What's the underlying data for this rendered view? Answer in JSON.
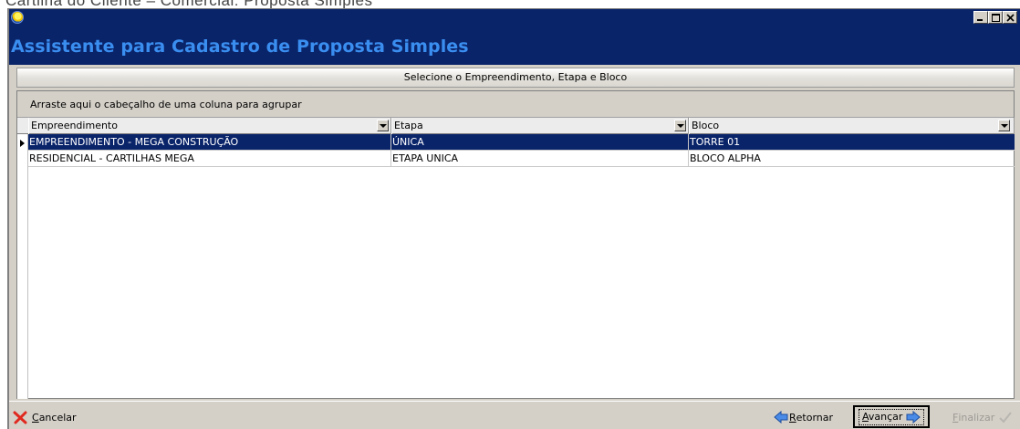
{
  "document_caption": "Cartilha do Cliente – Comercial: Proposta Simples",
  "window": {
    "title_icon": "app-globe-icon",
    "controls": [
      "minimize-icon",
      "maximize-icon",
      "close-icon"
    ]
  },
  "wizard": {
    "title": "Assistente para Cadastro de Proposta Simples",
    "step_label": "Selecione o Empreendimento, Etapa e Bloco"
  },
  "grid": {
    "group_hint": "Arraste aqui o cabeçalho de uma coluna para agrupar",
    "columns": [
      {
        "label": "Empreendimento"
      },
      {
        "label": "Etapa"
      },
      {
        "label": "Bloco"
      }
    ],
    "rows": [
      {
        "empreendimento": "EMPREENDIMENTO - MEGA CONSTRUÇÃO",
        "etapa": "ÚNICA",
        "bloco": "TORRE 01",
        "selected": true
      },
      {
        "empreendimento": "RESIDENCIAL - CARTILHAS MEGA",
        "etapa": "ETAPA UNICA",
        "bloco": "BLOCO ALPHA",
        "selected": false
      }
    ]
  },
  "footer": {
    "cancel": {
      "underline": "C",
      "rest": "ancelar",
      "icon": "red-x-icon"
    },
    "back": {
      "underline": "R",
      "rest": "etornar",
      "icon": "arrow-left-icon"
    },
    "next": {
      "underline": "A",
      "rest": "vançar",
      "icon": "arrow-right-icon"
    },
    "finish": {
      "underline": "F",
      "rest": "inalizar",
      "icon": "checkmark-icon",
      "enabled": false
    }
  },
  "colors": {
    "titlebar": "#0a246a",
    "title_text": "#3a8ef0",
    "selection": "#0a246a",
    "face": "#d4d0c8"
  }
}
